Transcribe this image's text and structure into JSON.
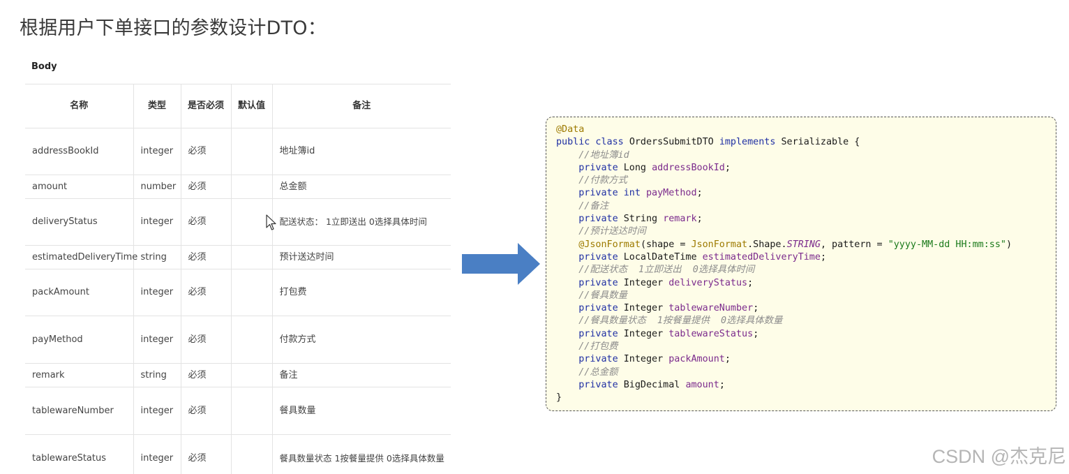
{
  "title": "根据用户下单接口的参数设计DTO：",
  "body_label": "Body",
  "table": {
    "headers": [
      "名称",
      "类型",
      "是否必须",
      "默认值",
      "备注"
    ],
    "rows": [
      {
        "name": "addressBookId",
        "type": "integer",
        "required": "必须",
        "default": "",
        "remark": "地址簿id"
      },
      {
        "name": "amount",
        "type": "number",
        "required": "必须",
        "default": "",
        "remark": "总金额"
      },
      {
        "name": "deliveryStatus",
        "type": "integer",
        "required": "必须",
        "default": "",
        "remark": "配送状态：  1立即送出  0选择具体时间"
      },
      {
        "name": "estimatedDeliveryTime",
        "type": "string",
        "required": "必须",
        "default": "",
        "remark": "预计送达时间"
      },
      {
        "name": "packAmount",
        "type": "integer",
        "required": "必须",
        "default": "",
        "remark": "打包费"
      },
      {
        "name": "payMethod",
        "type": "integer",
        "required": "必须",
        "default": "",
        "remark": "付款方式"
      },
      {
        "name": "remark",
        "type": "string",
        "required": "必须",
        "default": "",
        "remark": "备注"
      },
      {
        "name": "tablewareNumber",
        "type": "integer",
        "required": "必须",
        "default": "",
        "remark": "餐具数量"
      },
      {
        "name": "tablewareStatus",
        "type": "integer",
        "required": "必须",
        "default": "",
        "remark": "餐具数量状态  1按餐量提供  0选择具体数量"
      }
    ]
  },
  "code": {
    "lines": [
      [
        {
          "t": "@Data",
          "c": "annot"
        }
      ],
      [
        {
          "t": "public class ",
          "c": "kw"
        },
        {
          "t": "OrdersSubmitDTO ",
          "c": "plain"
        },
        {
          "t": "implements ",
          "c": "kw"
        },
        {
          "t": "Serializable {",
          "c": "plain"
        }
      ],
      [
        {
          "t": "    //地址簿id",
          "c": "comment"
        }
      ],
      [
        {
          "t": "    private ",
          "c": "kw"
        },
        {
          "t": "Long ",
          "c": "plain"
        },
        {
          "t": "addressBookId",
          "c": "field"
        },
        {
          "t": ";",
          "c": "plain"
        }
      ],
      [
        {
          "t": "    //付款方式",
          "c": "comment"
        }
      ],
      [
        {
          "t": "    private int ",
          "c": "kw"
        },
        {
          "t": "payMethod",
          "c": "field"
        },
        {
          "t": ";",
          "c": "plain"
        }
      ],
      [
        {
          "t": "    //备注",
          "c": "comment"
        }
      ],
      [
        {
          "t": "    private ",
          "c": "kw"
        },
        {
          "t": "String ",
          "c": "plain"
        },
        {
          "t": "remark",
          "c": "field"
        },
        {
          "t": ";",
          "c": "plain"
        }
      ],
      [
        {
          "t": "    //预计送达时间",
          "c": "comment"
        }
      ],
      [
        {
          "t": "    @JsonFormat",
          "c": "annot"
        },
        {
          "t": "(shape = ",
          "c": "plain"
        },
        {
          "t": "JsonFormat",
          "c": "annot"
        },
        {
          "t": ".Shape.",
          "c": "plain"
        },
        {
          "t": "STRING",
          "c": "const"
        },
        {
          "t": ", pattern = ",
          "c": "plain"
        },
        {
          "t": "\"yyyy-MM-dd HH:mm:ss\"",
          "c": "string"
        },
        {
          "t": ")",
          "c": "plain"
        }
      ],
      [
        {
          "t": "    private ",
          "c": "kw"
        },
        {
          "t": "LocalDateTime ",
          "c": "plain"
        },
        {
          "t": "estimatedDeliveryTime",
          "c": "field"
        },
        {
          "t": ";",
          "c": "plain"
        }
      ],
      [
        {
          "t": "    //配送状态  1立即送出  0选择具体时间",
          "c": "comment"
        }
      ],
      [
        {
          "t": "    private ",
          "c": "kw"
        },
        {
          "t": "Integer ",
          "c": "plain"
        },
        {
          "t": "deliveryStatus",
          "c": "field"
        },
        {
          "t": ";",
          "c": "plain"
        }
      ],
      [
        {
          "t": "    //餐具数量",
          "c": "comment"
        }
      ],
      [
        {
          "t": "    private ",
          "c": "kw"
        },
        {
          "t": "Integer ",
          "c": "plain"
        },
        {
          "t": "tablewareNumber",
          "c": "field"
        },
        {
          "t": ";",
          "c": "plain"
        }
      ],
      [
        {
          "t": "    //餐具数量状态  1按餐量提供  0选择具体数量",
          "c": "comment"
        }
      ],
      [
        {
          "t": "    private ",
          "c": "kw"
        },
        {
          "t": "Integer ",
          "c": "plain"
        },
        {
          "t": "tablewareStatus",
          "c": "field"
        },
        {
          "t": ";",
          "c": "plain"
        }
      ],
      [
        {
          "t": "    //打包费",
          "c": "comment"
        }
      ],
      [
        {
          "t": "    private ",
          "c": "kw"
        },
        {
          "t": "Integer ",
          "c": "plain"
        },
        {
          "t": "packAmount",
          "c": "field"
        },
        {
          "t": ";",
          "c": "plain"
        }
      ],
      [
        {
          "t": "    //总金额",
          "c": "comment"
        }
      ],
      [
        {
          "t": "    private ",
          "c": "kw"
        },
        {
          "t": "BigDecimal ",
          "c": "plain"
        },
        {
          "t": "amount",
          "c": "field"
        },
        {
          "t": ";",
          "c": "plain"
        }
      ],
      [
        {
          "t": "}",
          "c": "plain"
        }
      ]
    ]
  },
  "watermark": "CSDN @杰克尼",
  "icons": {
    "arrow": "right-arrow-icon",
    "cursor": "mouse-pointer-icon"
  },
  "colors": {
    "arrow": "#4a7fc4",
    "code_background": "#fefde8"
  }
}
